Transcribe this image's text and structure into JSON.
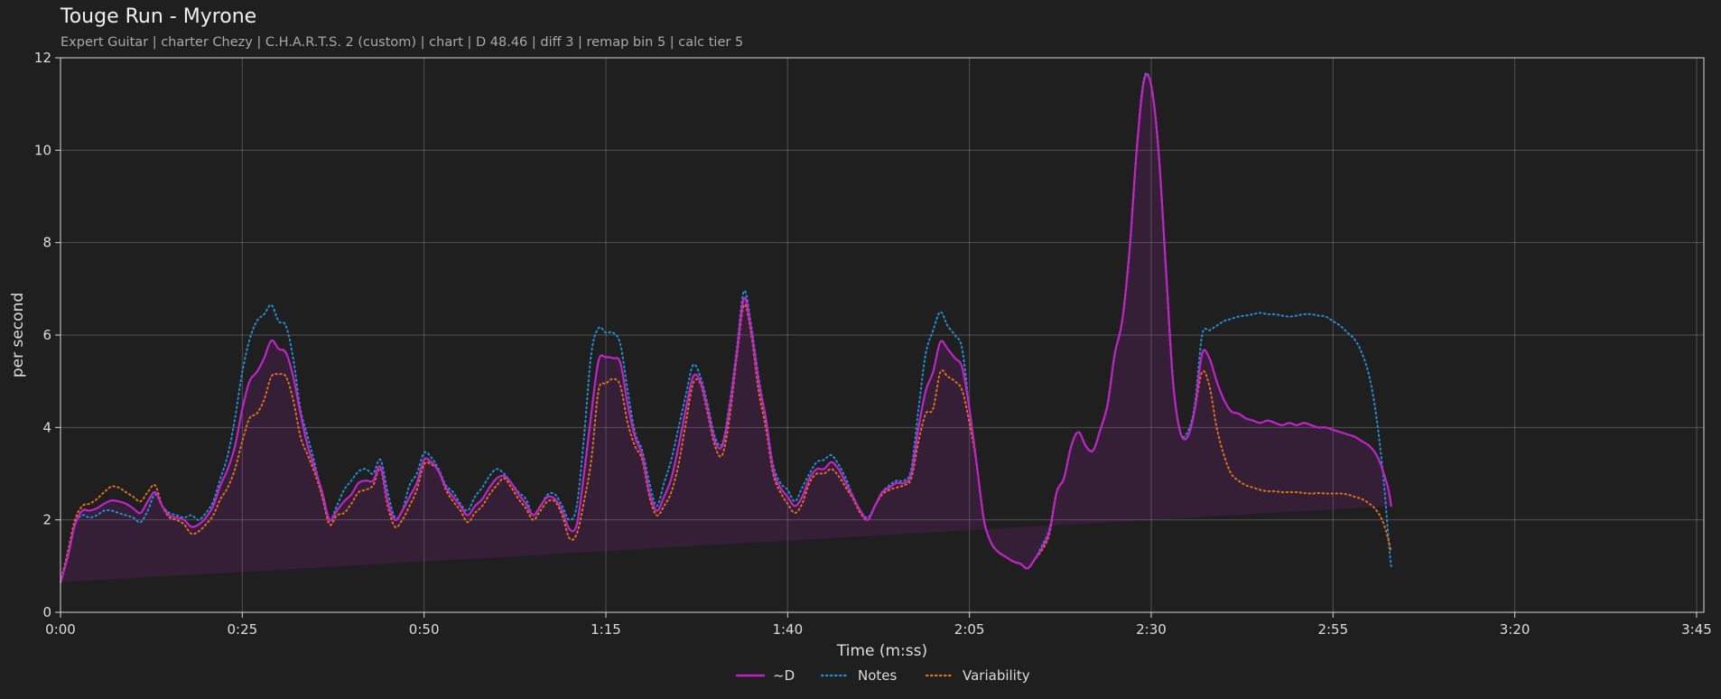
{
  "chart_data": {
    "type": "area",
    "title": "Touge Run - Myrone",
    "subtitle": "Expert Guitar  |  charter Chezy  |  C.H.A.R.T.S. 2 (custom)  |  chart  |  D 48.46  |  diff 3  |  remap bin 5  |  calc tier 5",
    "xlabel": "Time (m:ss)",
    "ylabel": "per second",
    "xlim": [
      0,
      226
    ],
    "ylim": [
      0,
      12
    ],
    "xticks": [
      0,
      25,
      50,
      75,
      100,
      125,
      150,
      175,
      200,
      225
    ],
    "xtick_labels": [
      "0:00",
      "0:25",
      "0:50",
      "1:15",
      "1:40",
      "2:05",
      "2:30",
      "2:55",
      "3:20",
      "3:45"
    ],
    "yticks": [
      0,
      2,
      4,
      6,
      8,
      10,
      12
    ],
    "ytick_labels": [
      "0",
      "2",
      "4",
      "6",
      "8",
      "10",
      "12"
    ],
    "grid": true,
    "legend_position": "bottom-center",
    "x": [
      0,
      1,
      2,
      3,
      4,
      5,
      6,
      7,
      8,
      9,
      10,
      11,
      12,
      13,
      14,
      15,
      16,
      17,
      18,
      19,
      20,
      21,
      22,
      23,
      24,
      25,
      26,
      27,
      28,
      29,
      30,
      31,
      32,
      33,
      34,
      35,
      36,
      37,
      38,
      39,
      40,
      41,
      42,
      43,
      44,
      45,
      46,
      47,
      48,
      49,
      50,
      51,
      52,
      53,
      54,
      55,
      56,
      57,
      58,
      59,
      60,
      61,
      62,
      63,
      64,
      65,
      66,
      67,
      68,
      69,
      70,
      71,
      72,
      73,
      74,
      75,
      76,
      77,
      78,
      79,
      80,
      81,
      82,
      83,
      84,
      85,
      86,
      87,
      88,
      89,
      90,
      91,
      92,
      93,
      94,
      95,
      96,
      97,
      98,
      99,
      100,
      101,
      102,
      103,
      104,
      105,
      106,
      107,
      108,
      109,
      110,
      111,
      112,
      113,
      114,
      115,
      116,
      117,
      118,
      119,
      120,
      121,
      122,
      123,
      124,
      125,
      126,
      127,
      128,
      129,
      130,
      131,
      132,
      133,
      134,
      135,
      136,
      137,
      138,
      139,
      140,
      141,
      142,
      143,
      144,
      145,
      146,
      147,
      148,
      149,
      150,
      151,
      152,
      153,
      154,
      155,
      156,
      157,
      158,
      159,
      160,
      161,
      162,
      163,
      164,
      165,
      166,
      167,
      168,
      169,
      170,
      171,
      172,
      173,
      174,
      175,
      176,
      177,
      178,
      179,
      180,
      181,
      182,
      183,
      184,
      185,
      186,
      187,
      188,
      189,
      190,
      191,
      192,
      193,
      194,
      195,
      196,
      197,
      198,
      199,
      200,
      201,
      202,
      203,
      204,
      205,
      206,
      207,
      208,
      209,
      210,
      211,
      212,
      213,
      214,
      215,
      216,
      217,
      218,
      219,
      220,
      221,
      222,
      223,
      224,
      225,
      226
    ],
    "series": [
      {
        "name": "~D",
        "color": "#c024c9",
        "style": "solid",
        "filled": true,
        "values": [
          0.65,
          1.2,
          1.9,
          2.2,
          2.2,
          2.25,
          2.35,
          2.42,
          2.4,
          2.35,
          2.25,
          2.15,
          2.4,
          2.6,
          2.3,
          2.1,
          2.05,
          2.0,
          1.85,
          1.9,
          2.05,
          2.3,
          2.75,
          3.1,
          3.6,
          4.4,
          5.0,
          5.2,
          5.5,
          5.88,
          5.7,
          5.62,
          5.1,
          4.3,
          3.6,
          3.1,
          2.6,
          2.0,
          2.2,
          2.4,
          2.55,
          2.8,
          2.85,
          2.85,
          3.15,
          2.4,
          2.0,
          2.2,
          2.5,
          2.8,
          3.3,
          3.25,
          3.05,
          2.7,
          2.5,
          2.3,
          2.1,
          2.3,
          2.45,
          2.7,
          2.9,
          2.95,
          2.8,
          2.55,
          2.35,
          2.1,
          2.3,
          2.5,
          2.45,
          2.2,
          1.8,
          1.9,
          3.0,
          4.3,
          5.45,
          5.52,
          5.5,
          5.4,
          4.5,
          3.8,
          3.4,
          2.6,
          2.2,
          2.5,
          2.9,
          3.6,
          4.4,
          5.1,
          5.0,
          4.4,
          3.7,
          3.6,
          4.4,
          5.6,
          6.8,
          6.1,
          5.0,
          4.2,
          3.1,
          2.7,
          2.5,
          2.3,
          2.5,
          2.9,
          3.1,
          3.1,
          3.25,
          3.1,
          2.8,
          2.5,
          2.2,
          2.0,
          2.3,
          2.6,
          2.7,
          2.8,
          2.8,
          3.0,
          4.0,
          4.8,
          5.2,
          5.85,
          5.7,
          5.5,
          5.3,
          4.4,
          3.2,
          2.0,
          1.5,
          1.3,
          1.2,
          1.1,
          1.05,
          0.95,
          1.15,
          1.4,
          1.75,
          2.6,
          2.9,
          3.6,
          3.9,
          3.6,
          3.5,
          3.95,
          4.5,
          5.6,
          6.3,
          7.8,
          10.0,
          11.5,
          11.4,
          10.0,
          7.5,
          5.0,
          3.9,
          3.8,
          4.4,
          5.6,
          5.5,
          5.0,
          4.6,
          4.35,
          4.3,
          4.2,
          4.15,
          4.1,
          4.15,
          4.1,
          4.05,
          4.1,
          4.05,
          4.1,
          4.05,
          4.0,
          4.0,
          3.95,
          3.9,
          3.85,
          3.8,
          3.7,
          3.6,
          3.4,
          3.0,
          2.3,
          0.5
        ]
      },
      {
        "name": "Notes",
        "color": "#1f8fd6",
        "style": "dotted",
        "filled": false,
        "values": [
          0.65,
          1.2,
          1.9,
          2.1,
          2.05,
          2.1,
          2.2,
          2.2,
          2.15,
          2.1,
          2.05,
          1.95,
          2.2,
          2.55,
          2.3,
          2.15,
          2.1,
          2.05,
          2.1,
          2.0,
          2.15,
          2.4,
          2.9,
          3.4,
          4.2,
          5.2,
          5.9,
          6.3,
          6.45,
          6.65,
          6.3,
          6.2,
          5.5,
          4.4,
          3.8,
          3.2,
          2.5,
          2.0,
          2.3,
          2.65,
          2.85,
          3.05,
          3.1,
          3.0,
          3.3,
          2.6,
          2.05,
          2.2,
          2.75,
          3.0,
          3.45,
          3.35,
          3.1,
          2.75,
          2.6,
          2.35,
          2.2,
          2.5,
          2.7,
          2.95,
          3.1,
          3.0,
          2.8,
          2.6,
          2.45,
          2.1,
          2.3,
          2.55,
          2.55,
          2.3,
          2.0,
          2.3,
          3.8,
          5.6,
          6.15,
          6.05,
          6.05,
          5.8,
          4.8,
          3.9,
          3.5,
          2.8,
          2.3,
          2.8,
          3.3,
          4.0,
          4.7,
          5.35,
          5.1,
          4.5,
          3.8,
          3.65,
          4.5,
          5.7,
          6.95,
          6.2,
          5.1,
          4.2,
          3.2,
          2.8,
          2.65,
          2.4,
          2.7,
          3.0,
          3.25,
          3.3,
          3.4,
          3.2,
          2.9,
          2.5,
          2.2,
          2.05,
          2.3,
          2.6,
          2.75,
          2.85,
          2.85,
          3.1,
          4.4,
          5.6,
          6.1,
          6.5,
          6.2,
          6.0,
          5.7,
          4.4,
          3.2,
          2.0,
          1.5,
          1.3,
          1.2,
          1.1,
          1.05,
          0.95,
          1.15,
          1.45,
          1.8,
          2.6,
          2.9,
          3.6,
          3.9,
          3.6,
          3.5,
          3.95,
          4.5,
          5.6,
          6.3,
          7.8,
          10.0,
          11.55,
          11.4,
          10.0,
          7.5,
          5.0,
          3.9,
          3.9,
          4.5,
          6.0,
          6.1,
          6.2,
          6.3,
          6.35,
          6.4,
          6.42,
          6.45,
          6.48,
          6.45,
          6.45,
          6.42,
          6.4,
          6.42,
          6.45,
          6.45,
          6.42,
          6.4,
          6.3,
          6.2,
          6.05,
          5.9,
          5.6,
          5.1,
          4.2,
          2.8,
          1.0,
          0.4
        ]
      },
      {
        "name": "Variability",
        "color": "#e0701a",
        "style": "dotted",
        "filled": false,
        "values": [
          0.65,
          1.3,
          2.0,
          2.3,
          2.35,
          2.45,
          2.6,
          2.72,
          2.7,
          2.6,
          2.5,
          2.4,
          2.6,
          2.75,
          2.3,
          2.05,
          2.0,
          1.9,
          1.7,
          1.75,
          1.9,
          2.1,
          2.45,
          2.7,
          3.1,
          3.7,
          4.2,
          4.3,
          4.6,
          5.1,
          5.15,
          5.1,
          4.6,
          3.8,
          3.4,
          3.0,
          2.5,
          1.9,
          2.1,
          2.15,
          2.35,
          2.6,
          2.65,
          2.75,
          3.1,
          2.3,
          1.85,
          2.0,
          2.3,
          2.65,
          3.2,
          3.2,
          3.05,
          2.65,
          2.4,
          2.2,
          1.95,
          2.15,
          2.3,
          2.55,
          2.75,
          2.9,
          2.7,
          2.45,
          2.25,
          2.0,
          2.2,
          2.4,
          2.4,
          2.1,
          1.6,
          1.7,
          2.4,
          3.3,
          4.8,
          4.95,
          5.05,
          4.9,
          4.1,
          3.6,
          3.3,
          2.5,
          2.1,
          2.3,
          2.6,
          3.2,
          4.1,
          4.95,
          4.95,
          4.3,
          3.6,
          3.4,
          4.2,
          5.5,
          6.65,
          6.0,
          4.8,
          4.0,
          3.0,
          2.6,
          2.35,
          2.15,
          2.35,
          2.8,
          3.0,
          3.0,
          3.1,
          2.95,
          2.7,
          2.45,
          2.15,
          2.0,
          2.3,
          2.55,
          2.65,
          2.7,
          2.75,
          2.9,
          3.7,
          4.3,
          4.4,
          5.2,
          5.1,
          5.0,
          4.8,
          4.1,
          3.2,
          2.0,
          1.5,
          1.3,
          1.2,
          1.1,
          1.05,
          0.95,
          1.15,
          1.35,
          1.7,
          2.6,
          2.9,
          3.6,
          3.9,
          3.6,
          3.5,
          3.95,
          4.5,
          5.6,
          6.3,
          7.8,
          10.0,
          11.5,
          11.4,
          10.0,
          7.5,
          5.0,
          3.9,
          3.8,
          4.4,
          5.2,
          4.9,
          4.0,
          3.4,
          3.0,
          2.85,
          2.75,
          2.7,
          2.65,
          2.62,
          2.62,
          2.6,
          2.6,
          2.6,
          2.58,
          2.57,
          2.58,
          2.57,
          2.57,
          2.57,
          2.55,
          2.5,
          2.45,
          2.35,
          2.2,
          1.9,
          1.3,
          0.4
        ]
      }
    ]
  }
}
